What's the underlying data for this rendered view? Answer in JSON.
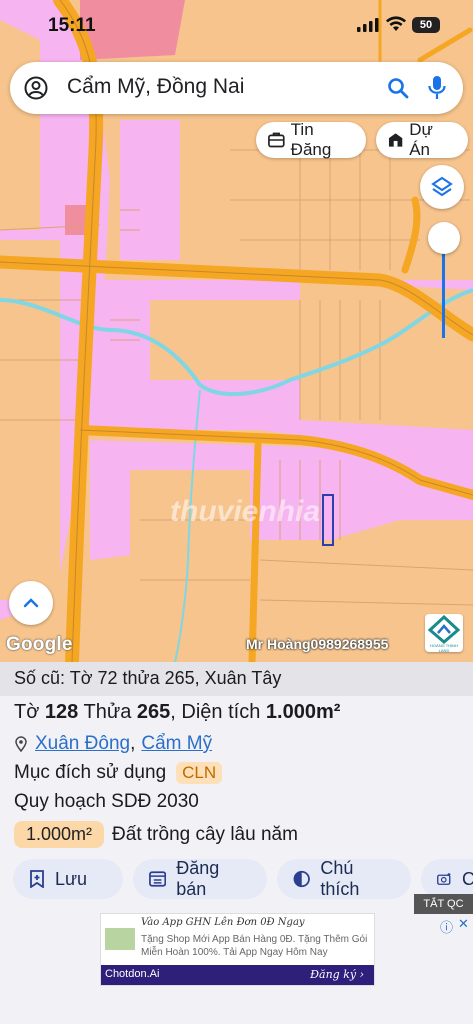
{
  "status_bar": {
    "time": "15:11",
    "battery": "50"
  },
  "search": {
    "query": "Cẩm Mỹ, Đồng Nai"
  },
  "chips": {
    "listings": "Tin Đăng",
    "projects": "Dự Án"
  },
  "map": {
    "attribution": "Google",
    "owner_label": "Mr Hoàng0989268955",
    "watermark": "thuvienhia",
    "logo_label": "HOÀNG THỊNH LAND"
  },
  "parcel": {
    "old_ref": "Số cũ: Tờ 72 thửa 265, Xuân Tây",
    "sheet_label": "Tờ",
    "sheet_no": "128",
    "plot_label": "Thửa",
    "plot_no": "265",
    "area_label": ", Diện tích",
    "area_value": "1.000m²",
    "ward": "Xuân Đông",
    "separator": ",",
    "district": "Cẩm Mỹ",
    "purpose_label": "Mục đích sử dụng",
    "purpose_code": "CLN",
    "plan_label": "Quy hoạch SDĐ 2030",
    "plan_area": "1.000m²",
    "plan_use": "Đất trồng cây lâu năm"
  },
  "actions": {
    "save": "Lưu",
    "post": "Đăng bán",
    "legend": "Chú thích",
    "photo": "C"
  },
  "ad": {
    "close_label": "TẮT QC",
    "headline": "Vào App GHN Lên Đơn 0Đ Ngay",
    "text": "Tặng Shop Mới App Bán Hàng 0Đ. Tặng Thêm Gói Miễn Hoàn 100%. Tải App Ngay Hôm Nay",
    "brand": "Chotdon.Ai",
    "cta": "Đăng ký"
  },
  "colors": {
    "land": "#f6c48c",
    "urban": "#f6b4f0",
    "road": "#f5a623",
    "river": "#7fd6e4",
    "accent": "#1a73e8"
  }
}
